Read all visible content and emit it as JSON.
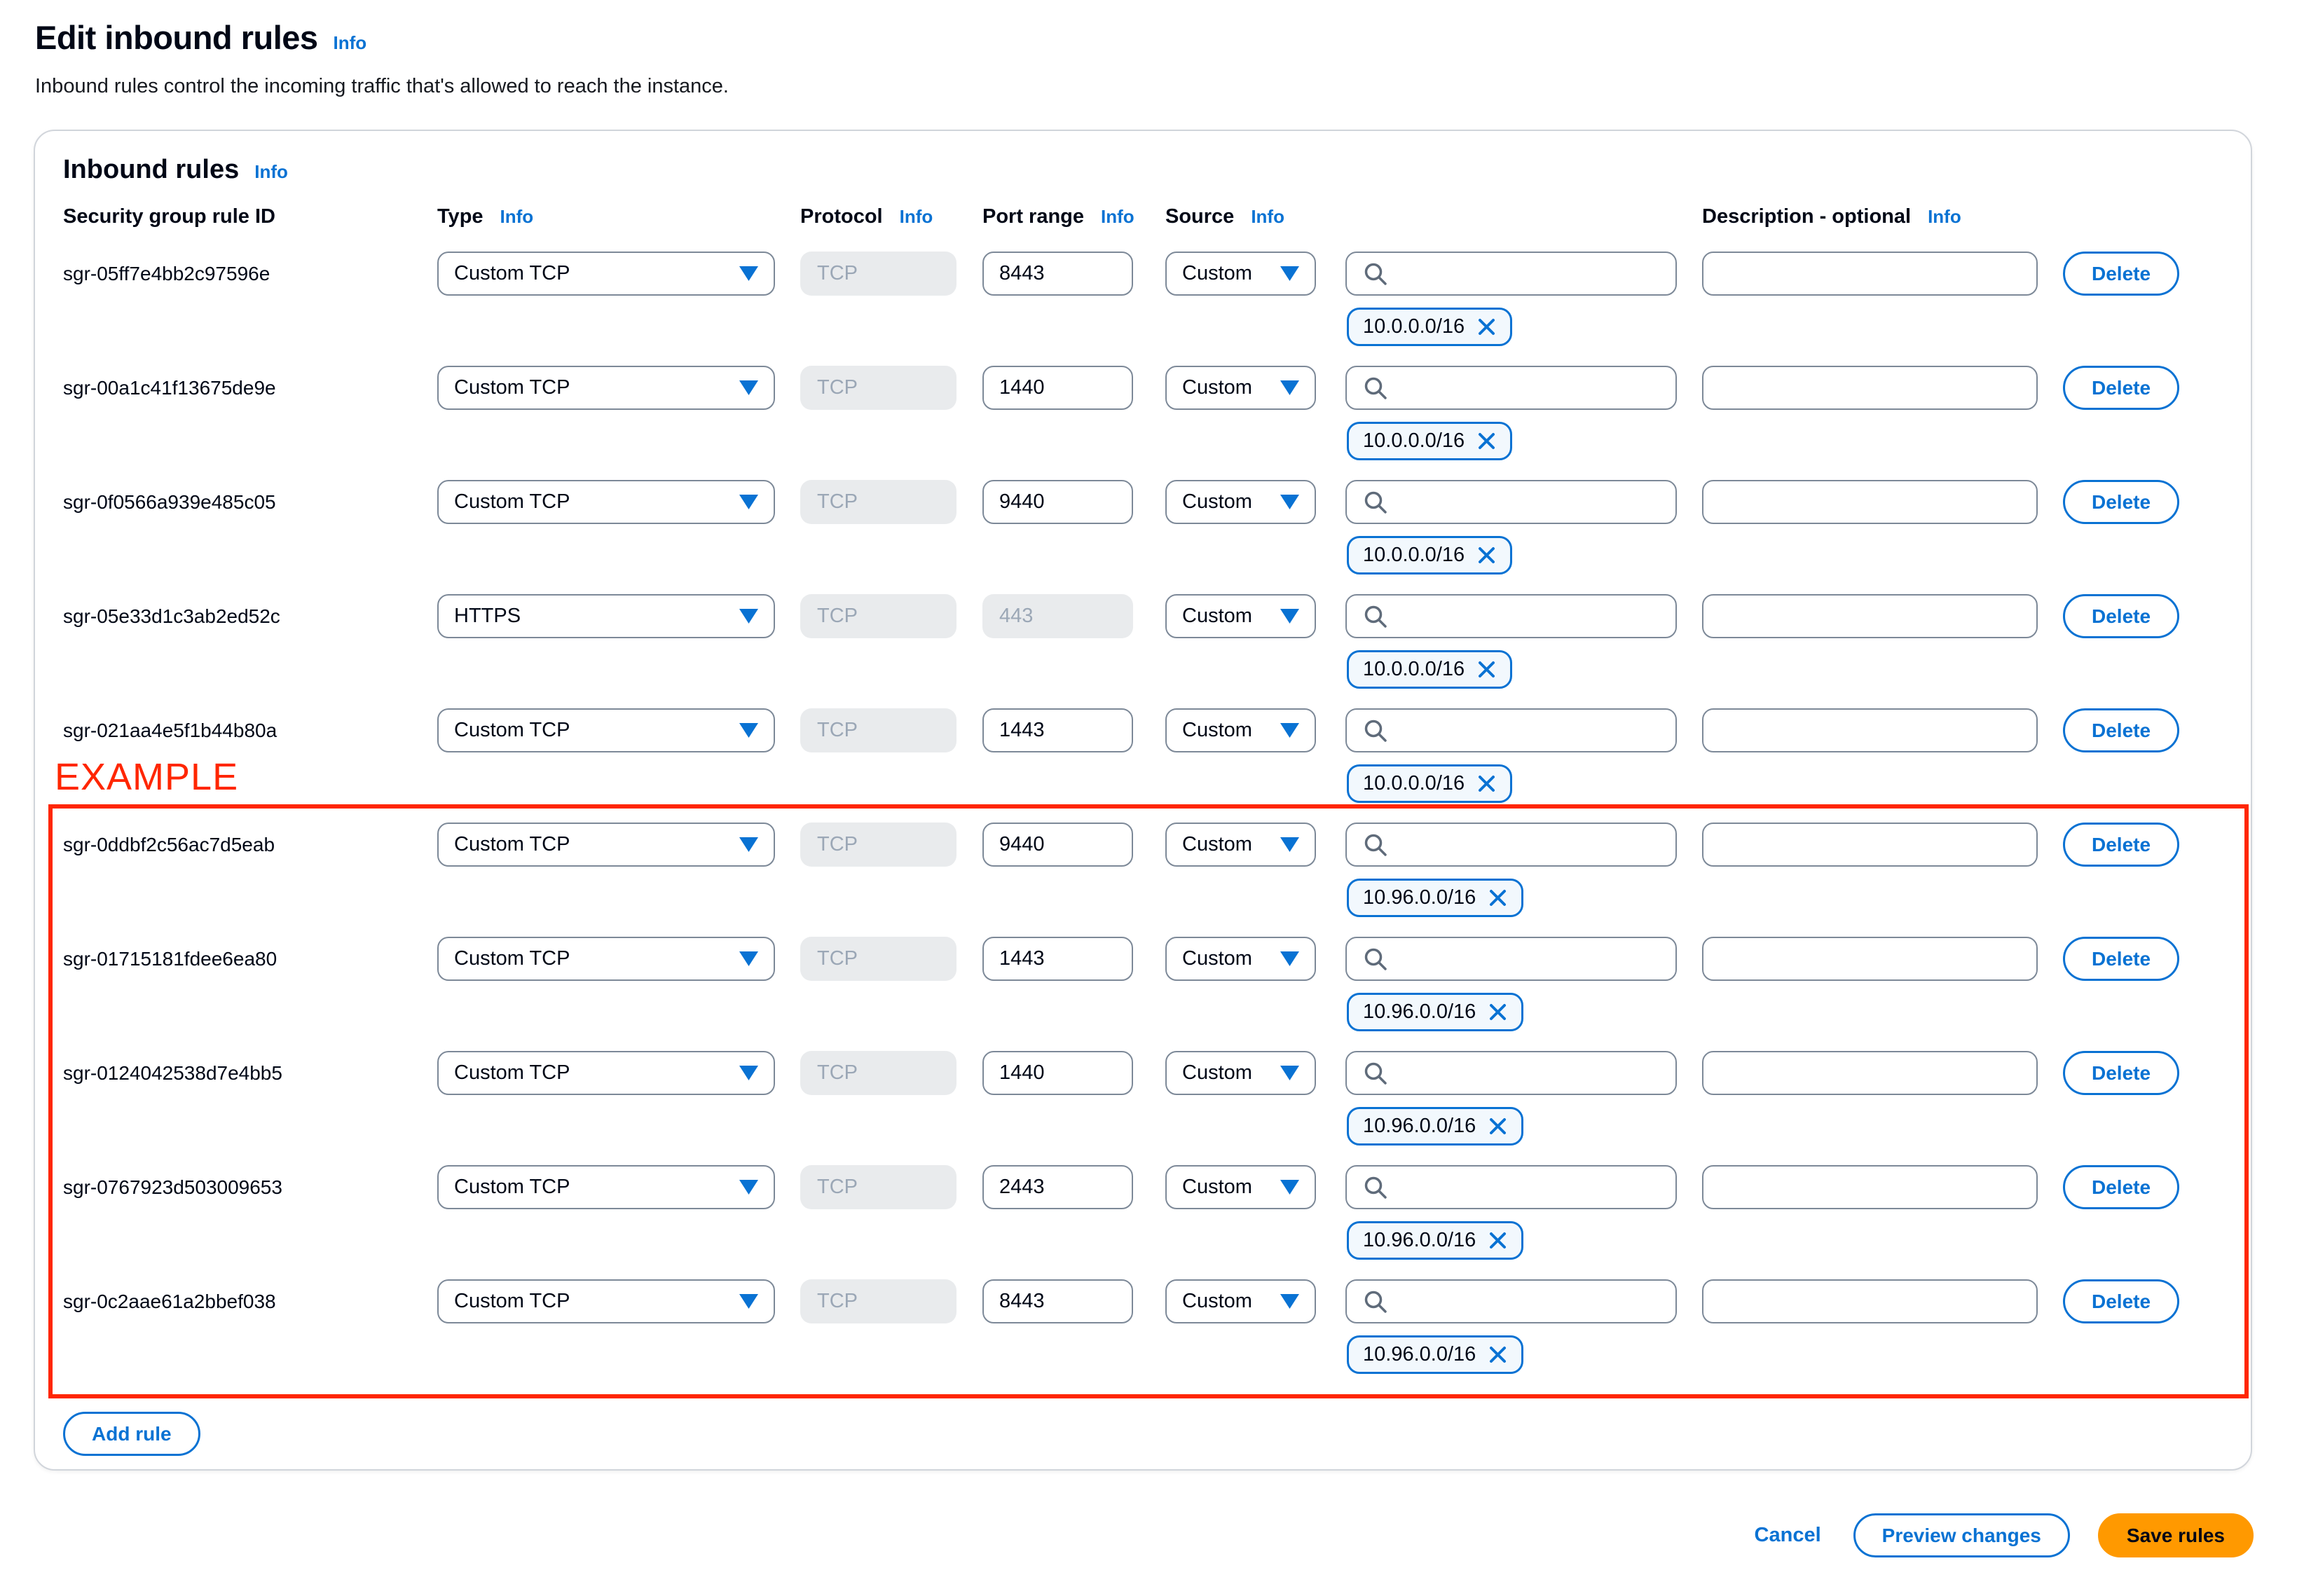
{
  "labels": {
    "info": "Info"
  },
  "page": {
    "title": "Edit inbound rules",
    "subtitle": "Inbound rules control the incoming traffic that's allowed to reach the instance."
  },
  "panel": {
    "title": "Inbound rules",
    "columns": {
      "rule_id": "Security group rule ID",
      "type": "Type",
      "protocol": "Protocol",
      "port_range": "Port range",
      "source": "Source",
      "description": "Description - optional"
    },
    "rows": [
      {
        "id": "sgr-05ff7e4bb2c97596e",
        "type": "Custom TCP",
        "protocol": "TCP",
        "port": "8443",
        "port_disabled": false,
        "source": "Custom",
        "cidr": "10.0.0.0/16"
      },
      {
        "id": "sgr-00a1c41f13675de9e",
        "type": "Custom TCP",
        "protocol": "TCP",
        "port": "1440",
        "port_disabled": false,
        "source": "Custom",
        "cidr": "10.0.0.0/16"
      },
      {
        "id": "sgr-0f0566a939e485c05",
        "type": "Custom TCP",
        "protocol": "TCP",
        "port": "9440",
        "port_disabled": false,
        "source": "Custom",
        "cidr": "10.0.0.0/16"
      },
      {
        "id": "sgr-05e33d1c3ab2ed52c",
        "type": "HTTPS",
        "protocol": "TCP",
        "port": "443",
        "port_disabled": true,
        "source": "Custom",
        "cidr": "10.0.0.0/16"
      },
      {
        "id": "sgr-021aa4e5f1b44b80a",
        "type": "Custom TCP",
        "protocol": "TCP",
        "port": "1443",
        "port_disabled": false,
        "source": "Custom",
        "cidr": "10.0.0.0/16"
      },
      {
        "id": "sgr-0ddbf2c56ac7d5eab",
        "type": "Custom TCP",
        "protocol": "TCP",
        "port": "9440",
        "port_disabled": false,
        "source": "Custom",
        "cidr": "10.96.0.0/16"
      },
      {
        "id": "sgr-01715181fdee6ea80",
        "type": "Custom TCP",
        "protocol": "TCP",
        "port": "1443",
        "port_disabled": false,
        "source": "Custom",
        "cidr": "10.96.0.0/16"
      },
      {
        "id": "sgr-0124042538d7e4bb5",
        "type": "Custom TCP",
        "protocol": "TCP",
        "port": "1440",
        "port_disabled": false,
        "source": "Custom",
        "cidr": "10.96.0.0/16"
      },
      {
        "id": "sgr-0767923d503009653",
        "type": "Custom TCP",
        "protocol": "TCP",
        "port": "2443",
        "port_disabled": false,
        "source": "Custom",
        "cidr": "10.96.0.0/16"
      },
      {
        "id": "sgr-0c2aae61a2bbef038",
        "type": "Custom TCP",
        "protocol": "TCP",
        "port": "8443",
        "port_disabled": false,
        "source": "Custom",
        "cidr": "10.96.0.0/16"
      }
    ],
    "buttons": {
      "delete": "Delete",
      "add_rule": "Add rule"
    }
  },
  "annotation": {
    "label": "EXAMPLE",
    "color": "#ff2600"
  },
  "footer": {
    "cancel": "Cancel",
    "preview": "Preview changes",
    "save": "Save rules"
  },
  "colors": {
    "accent_blue": "#0972d3",
    "save_orange": "#ff9900",
    "tag_bg": "#f2f8fd",
    "disabled_bg": "#e9ebed",
    "border_gray": "#7d8998"
  }
}
